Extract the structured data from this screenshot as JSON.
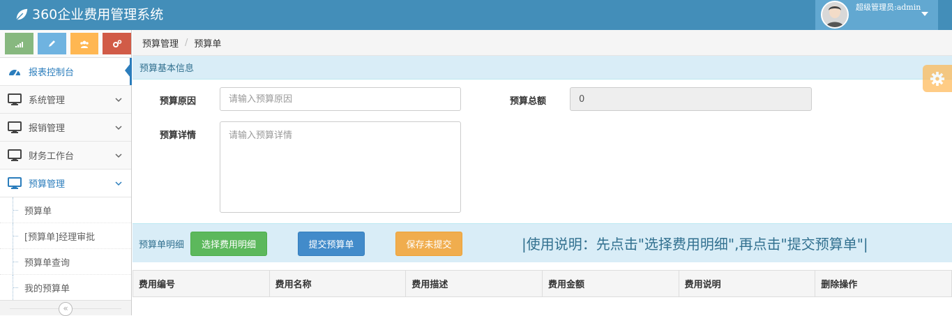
{
  "app": {
    "title": "360企业费用管理系统"
  },
  "user": {
    "label": "超级管理员:admin"
  },
  "sidebar": {
    "items": [
      {
        "label": "报表控制台"
      },
      {
        "label": "系统管理"
      },
      {
        "label": "报销管理"
      },
      {
        "label": "财务工作台"
      },
      {
        "label": "预算管理"
      }
    ],
    "subitems": [
      {
        "label": "预算单"
      },
      {
        "label": "[预算单]经理审批"
      },
      {
        "label": "预算单查询"
      },
      {
        "label": "我的预算单"
      }
    ],
    "collapse_glyph": "«"
  },
  "colors": {
    "brand": "#438eb9",
    "green": "#87b87f",
    "blue": "#6fb3e0",
    "orange": "#ffb752",
    "red": "#d15b47"
  },
  "breadcrumb": {
    "parent": "预算管理",
    "current": "预算单",
    "separator": "/"
  },
  "basic_info": {
    "title": "预算基本信息",
    "reason_label": "预算原因",
    "reason_placeholder": "请输入预算原因",
    "total_label": "预算总额",
    "total_value": "0",
    "detail_label": "预算详情",
    "detail_placeholder": "请输入预算详情"
  },
  "detail_section": {
    "title": "预算单明细",
    "select_button": "选择费用明细",
    "submit_button": "提交预算单",
    "save_button": "保存未提交",
    "usage_note": "|使用说明：先点击\"选择费用明细\",再点击\"提交预算单\"|"
  },
  "table": {
    "headers": [
      "费用编号",
      "费用名称",
      "费用描述",
      "费用金额",
      "费用说明",
      "删除操作"
    ]
  }
}
